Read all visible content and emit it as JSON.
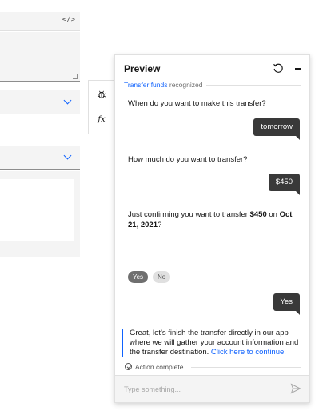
{
  "editor": {
    "code_icon": "</>"
  },
  "tools": {
    "debug_icon": "bug-icon",
    "function_icon": "function-icon",
    "function_label": "fx"
  },
  "preview": {
    "title": "Preview",
    "recognized_action": "Transfer funds",
    "recognized_suffix": "recognized",
    "messages": {
      "bot_1": "When do you want to make this transfer?",
      "user_1": "tomorrow",
      "bot_2": "How much do you want to transfer?",
      "user_2": "$450",
      "bot_3_prefix": "Just confirming you want to transfer ",
      "bot_3_amount": "$450",
      "bot_3_mid": " on ",
      "bot_3_date": "Oct 21, 2021",
      "bot_3_suffix": "?",
      "option_yes": "Yes",
      "option_no": "No",
      "user_3": "Yes",
      "final_text": "Great, let's finish the transfer directly in our app where we will gather your account information and the transfer destination. ",
      "final_link": "Click here to continue.",
      "action_complete": "Action complete"
    },
    "input_placeholder": "Type something..."
  },
  "colors": {
    "accent": "#0f62fe",
    "user_bubble": "#393939"
  }
}
